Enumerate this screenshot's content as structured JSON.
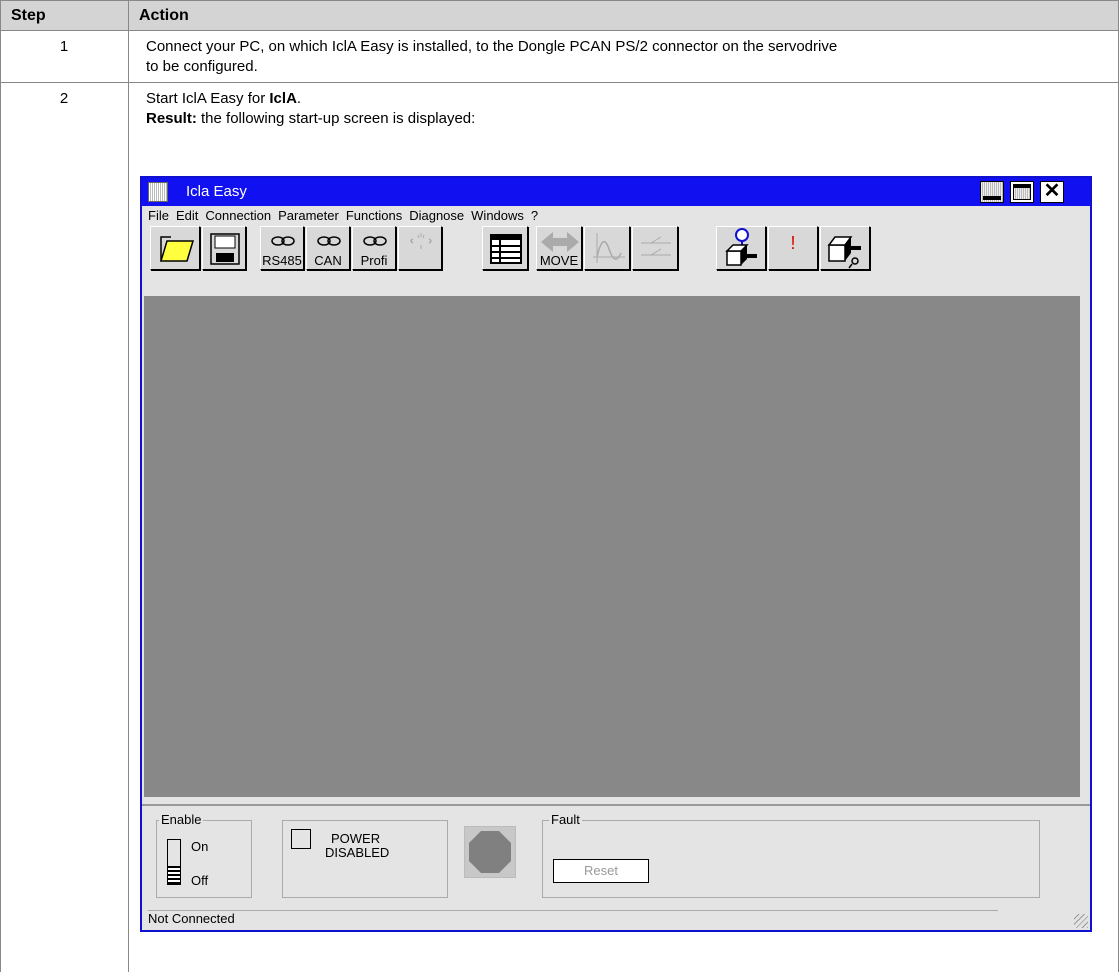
{
  "table": {
    "header": {
      "step": "Step",
      "action": "Action"
    },
    "rows": [
      {
        "step": "1",
        "action_line1": "Connect your PC, on which IclA Easy is installed, to the Dongle PCAN PS/2 connector on the servodrive",
        "action_line2": "to be configured."
      },
      {
        "step": "2",
        "action_line1_pre": "Start IclA Easy for ",
        "action_line1_bold": "IclA",
        "action_line1_post": ".",
        "result_label": "Result:",
        "result_text": " the following start-up screen is displayed:"
      }
    ]
  },
  "app": {
    "title": "Icla Easy",
    "menu": [
      "File",
      "Edit",
      "Connection",
      "Parameter",
      "Functions",
      "Diagnose",
      "Windows",
      "?"
    ],
    "toolbar": {
      "rs485": "RS485",
      "can": "CAN",
      "profi": "Profi",
      "move": "MOVE",
      "alert": "!"
    },
    "enable": {
      "label": "Enable",
      "on": "On",
      "off": "Off"
    },
    "power": {
      "line1": "POWER",
      "line2": "DISABLED"
    },
    "fault": {
      "label": "Fault",
      "reset": "Reset"
    },
    "status": "Not Connected",
    "colors": {
      "titlebar": "#1010f0",
      "workspace": "#888888"
    }
  }
}
